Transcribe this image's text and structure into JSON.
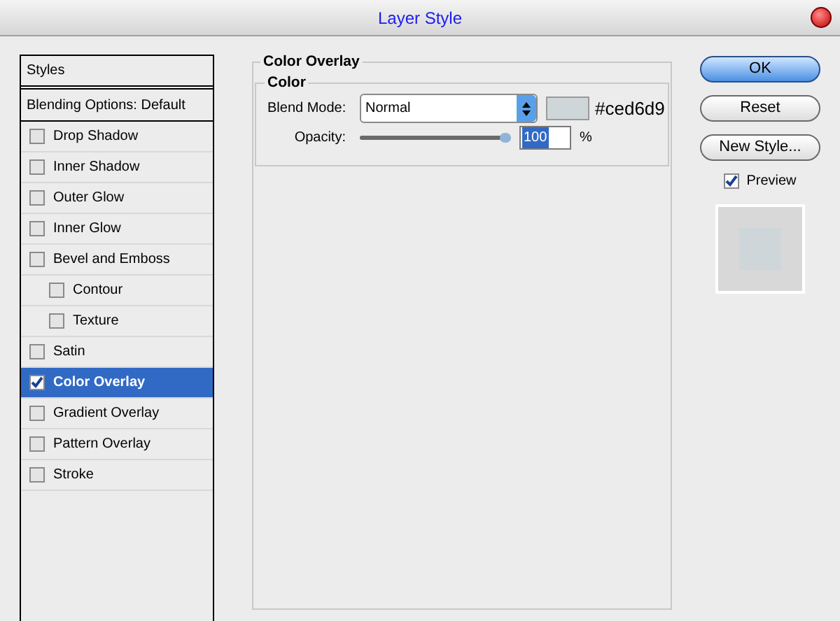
{
  "window": {
    "title": "Layer Style"
  },
  "styles_list": {
    "header": "Styles",
    "blending": "Blending Options: Default",
    "items": [
      {
        "label": "Drop Shadow",
        "checked": false,
        "selected": false
      },
      {
        "label": "Inner Shadow",
        "checked": false,
        "selected": false
      },
      {
        "label": "Outer Glow",
        "checked": false,
        "selected": false
      },
      {
        "label": "Inner Glow",
        "checked": false,
        "selected": false
      },
      {
        "label": "Bevel and Emboss",
        "checked": false,
        "selected": false,
        "children": [
          {
            "label": "Contour",
            "checked": false,
            "selected": false
          },
          {
            "label": "Texture",
            "checked": false,
            "selected": false
          }
        ]
      },
      {
        "label": "Satin",
        "checked": false,
        "selected": false
      },
      {
        "label": "Color Overlay",
        "checked": true,
        "selected": true
      },
      {
        "label": "Gradient Overlay",
        "checked": false,
        "selected": false
      },
      {
        "label": "Pattern Overlay",
        "checked": false,
        "selected": false
      },
      {
        "label": "Stroke",
        "checked": false,
        "selected": false
      }
    ]
  },
  "panel": {
    "title": "Color Overlay",
    "group": "Color",
    "blend_mode_label": "Blend Mode:",
    "blend_mode": "Normal",
    "color": "#ced6d9",
    "color_text": "#ced6d9",
    "opacity_label": "Opacity:",
    "opacity": {
      "level": 1
    },
    "opacity_value": "100",
    "opacity_unit": "%"
  },
  "buttons": [
    "OK",
    "Reset",
    "New Style..."
  ],
  "preview": {
    "label": "Preview",
    "checked": true,
    "color": "#ced6d9"
  }
}
